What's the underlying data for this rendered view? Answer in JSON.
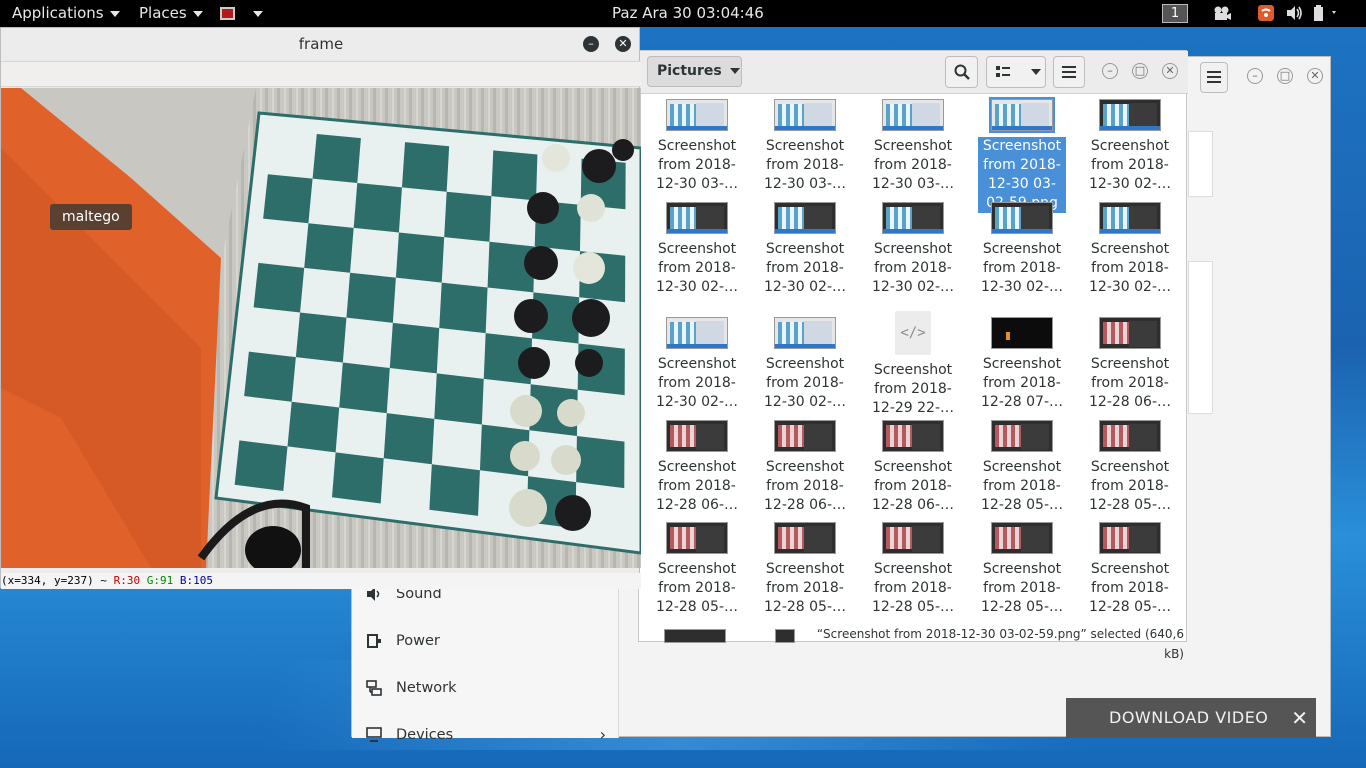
{
  "topbar": {
    "applications": "Applications",
    "places": "Places",
    "clock": "Paz Ara 30  03:04:46",
    "workspace": "1"
  },
  "settings_window": {
    "sidebar_items": [
      {
        "label": "Sound",
        "icon": "speaker-icon"
      },
      {
        "label": "Power",
        "icon": "power-icon"
      },
      {
        "label": "Network",
        "icon": "network-icon"
      },
      {
        "label": "Devices",
        "icon": "devices-icon"
      }
    ]
  },
  "files_window": {
    "location": "Pictures",
    "status": "“Screenshot from 2018-12-30 03-02-59.png” selected  (640,6 kB)",
    "items": [
      {
        "l1": "Screenshot",
        "l2": "from 2018-",
        "l3": "12-30 03-…",
        "thumb": "light"
      },
      {
        "l1": "Screenshot",
        "l2": "from 2018-",
        "l3": "12-30 03-…",
        "thumb": "light"
      },
      {
        "l1": "Screenshot",
        "l2": "from 2018-",
        "l3": "12-30 03-…",
        "thumb": "light"
      },
      {
        "l1": "Screenshot",
        "l2": "from 2018-",
        "l3": "12-30 03-",
        "l4": "02-59.png",
        "thumb": "light",
        "selected": true
      },
      {
        "l1": "Screenshot",
        "l2": "from 2018-",
        "l3": "12-30 02-…",
        "thumb": "dark"
      },
      {
        "l1": "Screenshot",
        "l2": "from 2018-",
        "l3": "12-30 02-…",
        "thumb": "dark"
      },
      {
        "l1": "Screenshot",
        "l2": "from 2018-",
        "l3": "12-30 02-…",
        "thumb": "dark"
      },
      {
        "l1": "Screenshot",
        "l2": "from 2018-",
        "l3": "12-30 02-…",
        "thumb": "dark"
      },
      {
        "l1": "Screenshot",
        "l2": "from 2018-",
        "l3": "12-30 02-…",
        "thumb": "dark"
      },
      {
        "l1": "Screenshot",
        "l2": "from 2018-",
        "l3": "12-30 02-…",
        "thumb": "dark"
      },
      {
        "l1": "Screenshot",
        "l2": "from 2018-",
        "l3": "12-30 02-…",
        "thumb": "light"
      },
      {
        "l1": "Screenshot",
        "l2": "from 2018-",
        "l3": "12-30 02-…",
        "thumb": "light"
      },
      {
        "l1": "Screenshot",
        "l2": "from 2018-",
        "l3": "12-29 22-…",
        "thumb": "code"
      },
      {
        "l1": "Screenshot",
        "l2": "from 2018-",
        "l3": "12-28 07-…",
        "thumb": "black"
      },
      {
        "l1": "Screenshot",
        "l2": "from 2018-",
        "l3": "12-28 06-…",
        "thumb": "red"
      },
      {
        "l1": "Screenshot",
        "l2": "from 2018-",
        "l3": "12-28 06-…",
        "thumb": "red"
      },
      {
        "l1": "Screenshot",
        "l2": "from 2018-",
        "l3": "12-28 06-…",
        "thumb": "red"
      },
      {
        "l1": "Screenshot",
        "l2": "from 2018-",
        "l3": "12-28 06-…",
        "thumb": "red"
      },
      {
        "l1": "Screenshot",
        "l2": "from 2018-",
        "l3": "12-28 05-…",
        "thumb": "red"
      },
      {
        "l1": "Screenshot",
        "l2": "from 2018-",
        "l3": "12-28 05-…",
        "thumb": "red"
      },
      {
        "l1": "Screenshot",
        "l2": "from 2018-",
        "l3": "12-28 05-…",
        "thumb": "red"
      },
      {
        "l1": "Screenshot",
        "l2": "from 2018-",
        "l3": "12-28 05-…",
        "thumb": "red"
      },
      {
        "l1": "Screenshot",
        "l2": "from 2018-",
        "l3": "12-28 05-…",
        "thumb": "red"
      },
      {
        "l1": "Screenshot",
        "l2": "from 2018-",
        "l3": "12-28 05-…",
        "thumb": "red"
      },
      {
        "l1": "Screenshot",
        "l2": "from 2018-",
        "l3": "12-28 05-…",
        "thumb": "red"
      }
    ]
  },
  "frame_window": {
    "title": "frame",
    "pixel_info": {
      "coords": "(x=334, y=237) ~",
      "r": "R:30",
      "g": "G:91",
      "b": "B:105"
    }
  },
  "tooltip": "maltego",
  "download_banner": {
    "label": "DOWNLOAD VIDEO",
    "close": "✕"
  },
  "colors": {
    "selection": "#4a90d9",
    "board_dark": "#2e6e6a",
    "board_light": "#e8f0f0",
    "orange": "#e0612a"
  }
}
